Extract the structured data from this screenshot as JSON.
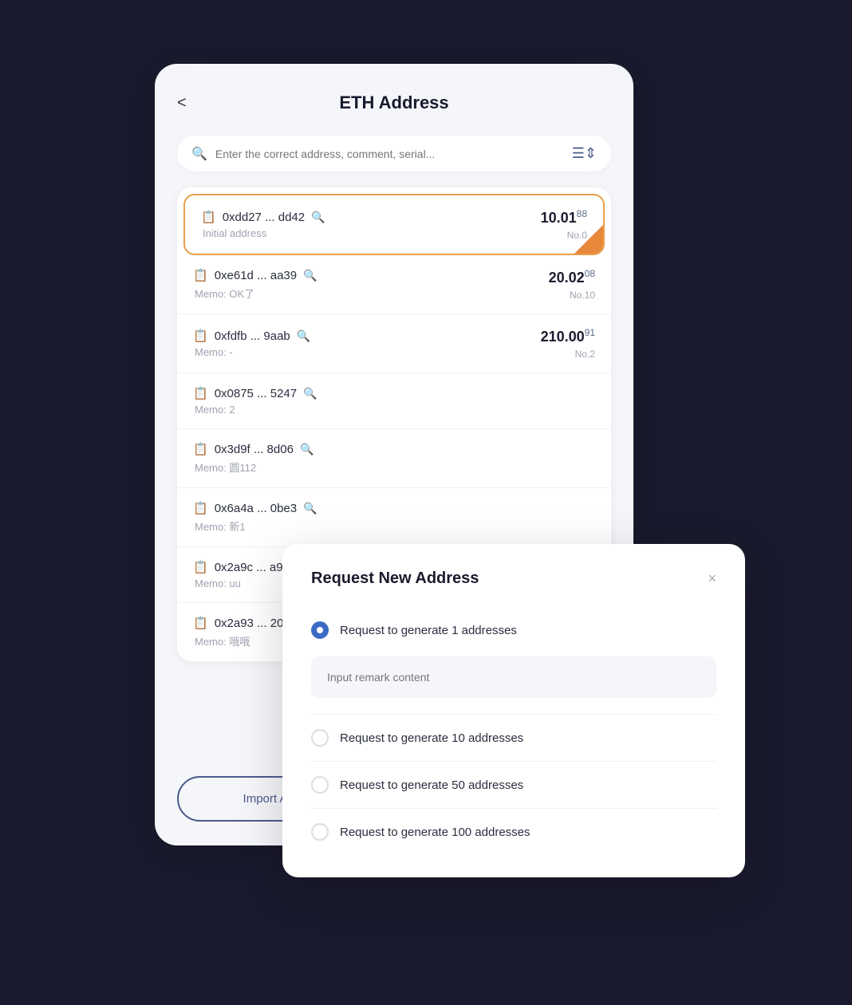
{
  "header": {
    "title": "ETH Address",
    "back_label": "<"
  },
  "search": {
    "placeholder": "Enter the correct address, comment, serial..."
  },
  "addresses": [
    {
      "id": "addr-1",
      "address": "0xdd27 ... dd42",
      "memo": "Initial address",
      "amount_main": "10.01",
      "amount_sup": "88",
      "badge": "No.0",
      "active": true
    },
    {
      "id": "addr-2",
      "address": "0xe61d ... aa39",
      "memo": "Memo: OK了",
      "amount_main": "20.02",
      "amount_sup": "08",
      "badge": "No.10",
      "active": false
    },
    {
      "id": "addr-3",
      "address": "0xfdfb ... 9aab",
      "memo": "Memo: -",
      "amount_main": "210.00",
      "amount_sup": "91",
      "badge": "No.2",
      "active": false
    },
    {
      "id": "addr-4",
      "address": "0x0875 ... 5247",
      "memo": "Memo: 2",
      "amount_main": "",
      "amount_sup": "",
      "badge": "",
      "active": false
    },
    {
      "id": "addr-5",
      "address": "0x3d9f ... 8d06",
      "memo": "Memo: 圆112",
      "amount_main": "",
      "amount_sup": "",
      "badge": "",
      "active": false
    },
    {
      "id": "addr-6",
      "address": "0x6a4a ... 0be3",
      "memo": "Memo: 新1",
      "amount_main": "",
      "amount_sup": "",
      "badge": "",
      "active": false
    },
    {
      "id": "addr-7",
      "address": "0x2a9c ... a904",
      "memo": "Memo: uu",
      "amount_main": "",
      "amount_sup": "",
      "badge": "",
      "active": false
    },
    {
      "id": "addr-8",
      "address": "0x2a93 ... 2006",
      "memo": "Memo: 哦哦",
      "amount_main": "",
      "amount_sup": "",
      "badge": "",
      "active": false
    }
  ],
  "buttons": {
    "import": "Import Address",
    "request": "Request New Address"
  },
  "modal": {
    "title": "Request New Address",
    "close_label": "×",
    "remark_placeholder": "Input remark content",
    "options": [
      {
        "label": "Request to generate 1 addresses",
        "checked": true
      },
      {
        "label": "Request to generate 10 addresses",
        "checked": false
      },
      {
        "label": "Request to generate 50 addresses",
        "checked": false
      },
      {
        "label": "Request to generate 100 addresses",
        "checked": false
      }
    ]
  }
}
